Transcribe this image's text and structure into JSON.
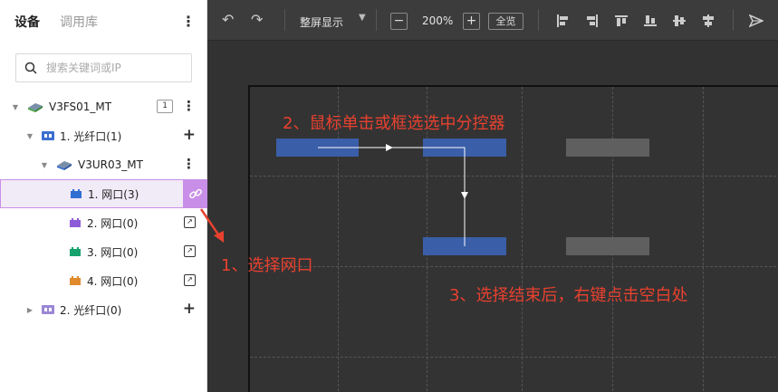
{
  "sidebar": {
    "tabs": [
      {
        "label": "设备",
        "active": true
      },
      {
        "label": "调用库",
        "active": false
      }
    ],
    "search_placeholder": "搜索关键词或IP",
    "tree": [
      {
        "label": "V3FS01_MT",
        "badge": "1",
        "icon": "device-icon"
      },
      {
        "label": "1. 光纤口(1)",
        "icon": "fiber-port-icon"
      },
      {
        "label": "V3UR03_MT",
        "icon": "device-icon"
      },
      {
        "label": "1. 网口(3)",
        "icon": "network-port-icon",
        "color": "#2f6fd1",
        "selected": true
      },
      {
        "label": "2. 网口(0)",
        "icon": "network-port-icon",
        "color": "#8e5cd9"
      },
      {
        "label": "3. 网口(0)",
        "icon": "network-port-icon",
        "color": "#17a36b"
      },
      {
        "label": "4. 网口(0)",
        "icon": "network-port-icon",
        "color": "#e08a2e"
      },
      {
        "label": "2. 光纤口(0)",
        "icon": "fiber-port-icon"
      }
    ]
  },
  "toolbar": {
    "display_mode": "整屏显示",
    "zoom": "200%",
    "overview": "全览"
  },
  "annotations": {
    "step1": "1、选择网口",
    "step2": "2、鼠标单击或框选选中分控器",
    "step3": "3、选择结束后，右键点击空白处"
  },
  "colors": {
    "accent": "#c98ee8",
    "annotation": "#e8412f",
    "selected_block": "#3a5ea8",
    "unselected_block": "#5f5f5f"
  }
}
